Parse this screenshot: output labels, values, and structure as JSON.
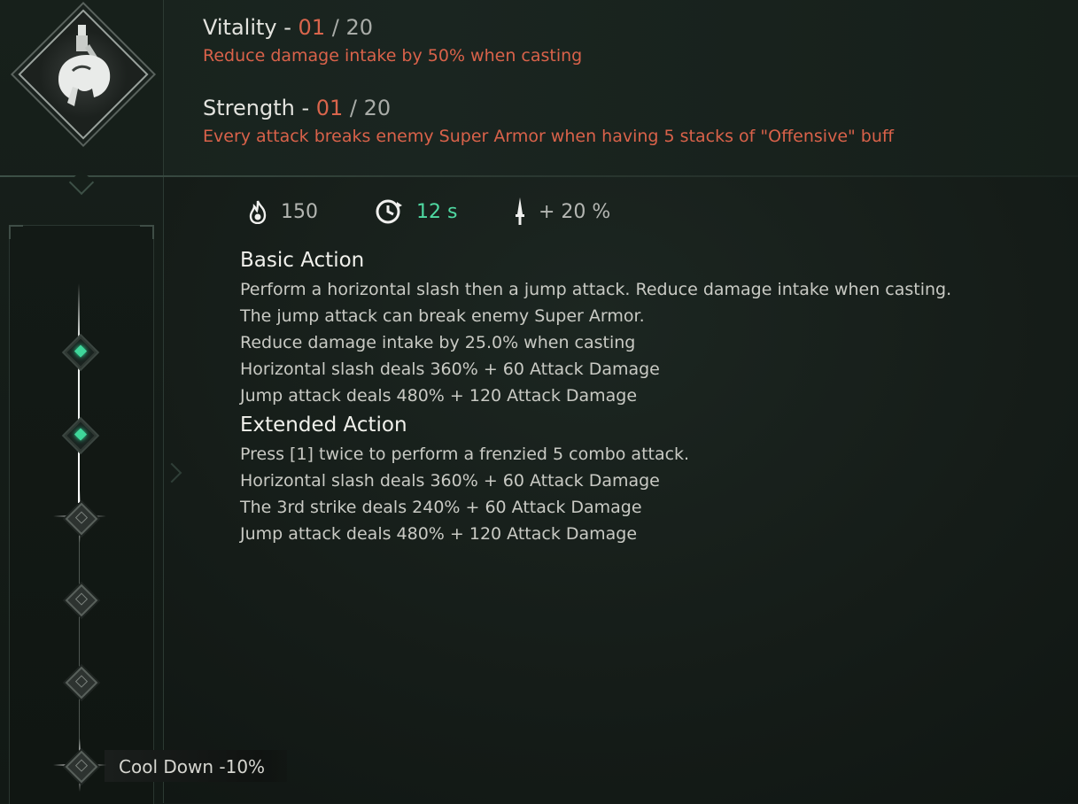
{
  "header": {
    "vitality": {
      "name": "Vitality",
      "current": "01",
      "max": "20",
      "description": "Reduce damage intake by 50% when casting"
    },
    "strength": {
      "name": "Strength",
      "current": "01",
      "max": "20",
      "description": "Every attack breaks enemy Super Armor when having 5 stacks of \"Offensive\" buff"
    }
  },
  "stats": {
    "cost": "150",
    "cooldown": "12 s",
    "damage_bonus": "+ 20 %"
  },
  "basic_action": {
    "title": "Basic Action",
    "lines": [
      "Perform a horizontal slash then a jump attack. Reduce damage intake when casting.",
      "The jump attack can break enemy Super Armor.",
      "Reduce damage intake by 25.0% when casting",
      "Horizontal slash deals 360% + 60 Attack Damage",
      "Jump attack deals 480% + 120 Attack Damage"
    ]
  },
  "extended_action": {
    "title": "Extended Action",
    "lines": [
      "Press [1] twice to perform a frenzied 5 combo attack.",
      "Horizontal slash deals 360% + 60 Attack Damage",
      "The 3rd strike deals 240% + 60 Attack Damage",
      "Jump attack deals 480% + 120 Attack Damage"
    ]
  },
  "progression": {
    "nodes": [
      "unlocked",
      "unlocked",
      "locked",
      "locked",
      "locked",
      "locked"
    ],
    "bonus_label": "Cool Down -10%"
  },
  "colors": {
    "accent_red": "#d9654c",
    "accent_green": "#3fd69a",
    "cooldown_text": "#4fd9a2"
  },
  "icons": {
    "skill": "knight-helmet-icon",
    "cost": "flame-icon",
    "cooldown": "clock-icon",
    "damage": "dagger-icon"
  }
}
